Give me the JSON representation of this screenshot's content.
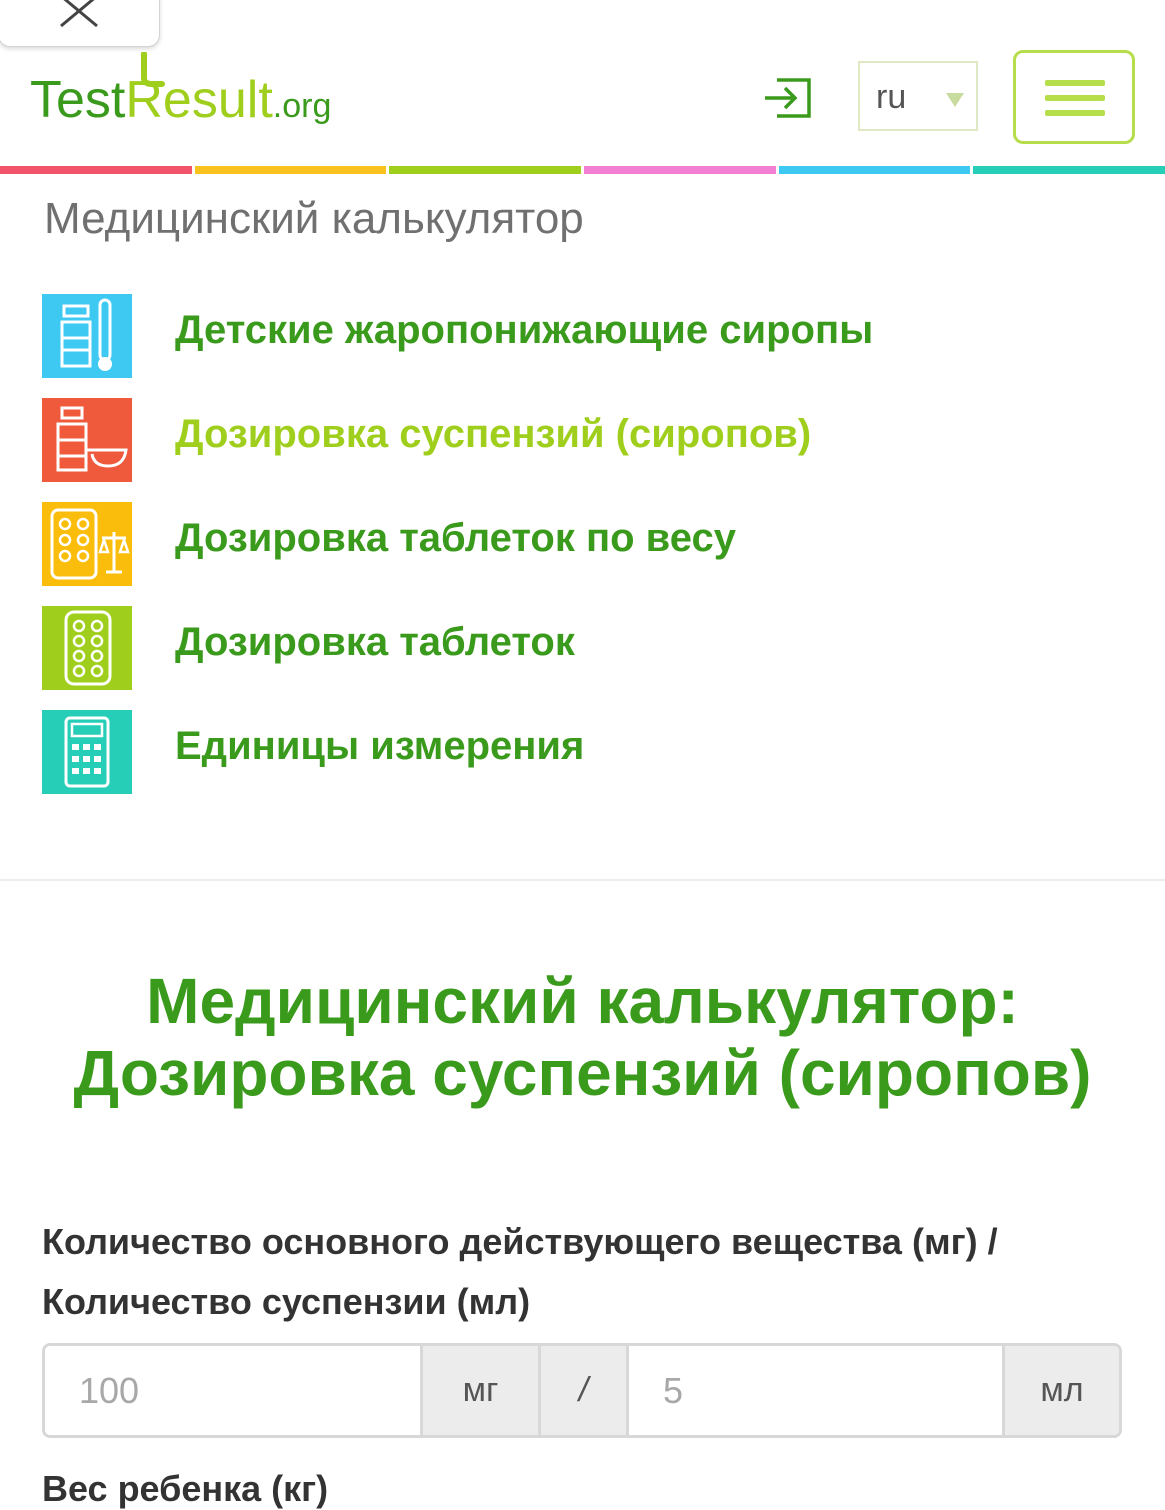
{
  "header": {
    "logo": {
      "part1": "Test",
      "part2": "Result",
      "part3": ".org"
    },
    "language": "ru"
  },
  "stripe_colors": [
    "#f0536a",
    "#f9c21c",
    "#9fcf1c",
    "#f27fd1",
    "#3ec9f2",
    "#26cdb7"
  ],
  "section_title": "Медицинский калькулятор",
  "calculators": [
    {
      "label": "Детские жаропонижающие сиропы",
      "icon": "syrup-thermometer-icon",
      "icon_color": "#3ec9f2",
      "label_color": "#3a9a1c"
    },
    {
      "label": "Дозировка суспензий (сиропов)",
      "icon": "bottle-spoon-icon",
      "icon_color": "#f05a3c",
      "label_color": "#9fcf1c"
    },
    {
      "label": "Дозировка таблеток по весу",
      "icon": "pills-scale-icon",
      "icon_color": "#fbbd0b",
      "label_color": "#3a9a1c"
    },
    {
      "label": "Дозировка таблеток",
      "icon": "pills-blister-icon",
      "icon_color": "#9fcf1c",
      "label_color": "#3a9a1c"
    },
    {
      "label": "Единицы измерения",
      "icon": "calculator-icon",
      "icon_color": "#26cdb7",
      "label_color": "#3a9a1c"
    }
  ],
  "page_title": {
    "line1": "Медицинский калькулятор:",
    "line2": "Дозировка суспензий (сиропов)"
  },
  "form": {
    "concentration_label": "Количество основного действующего вещества (мг) / Количество суспензии (мл)",
    "mg_placeholder": "100",
    "mg_unit": "мг",
    "separator": "/",
    "ml_placeholder": "5",
    "ml_unit": "мл",
    "weight_label": "Вес ребенка (кг)"
  }
}
